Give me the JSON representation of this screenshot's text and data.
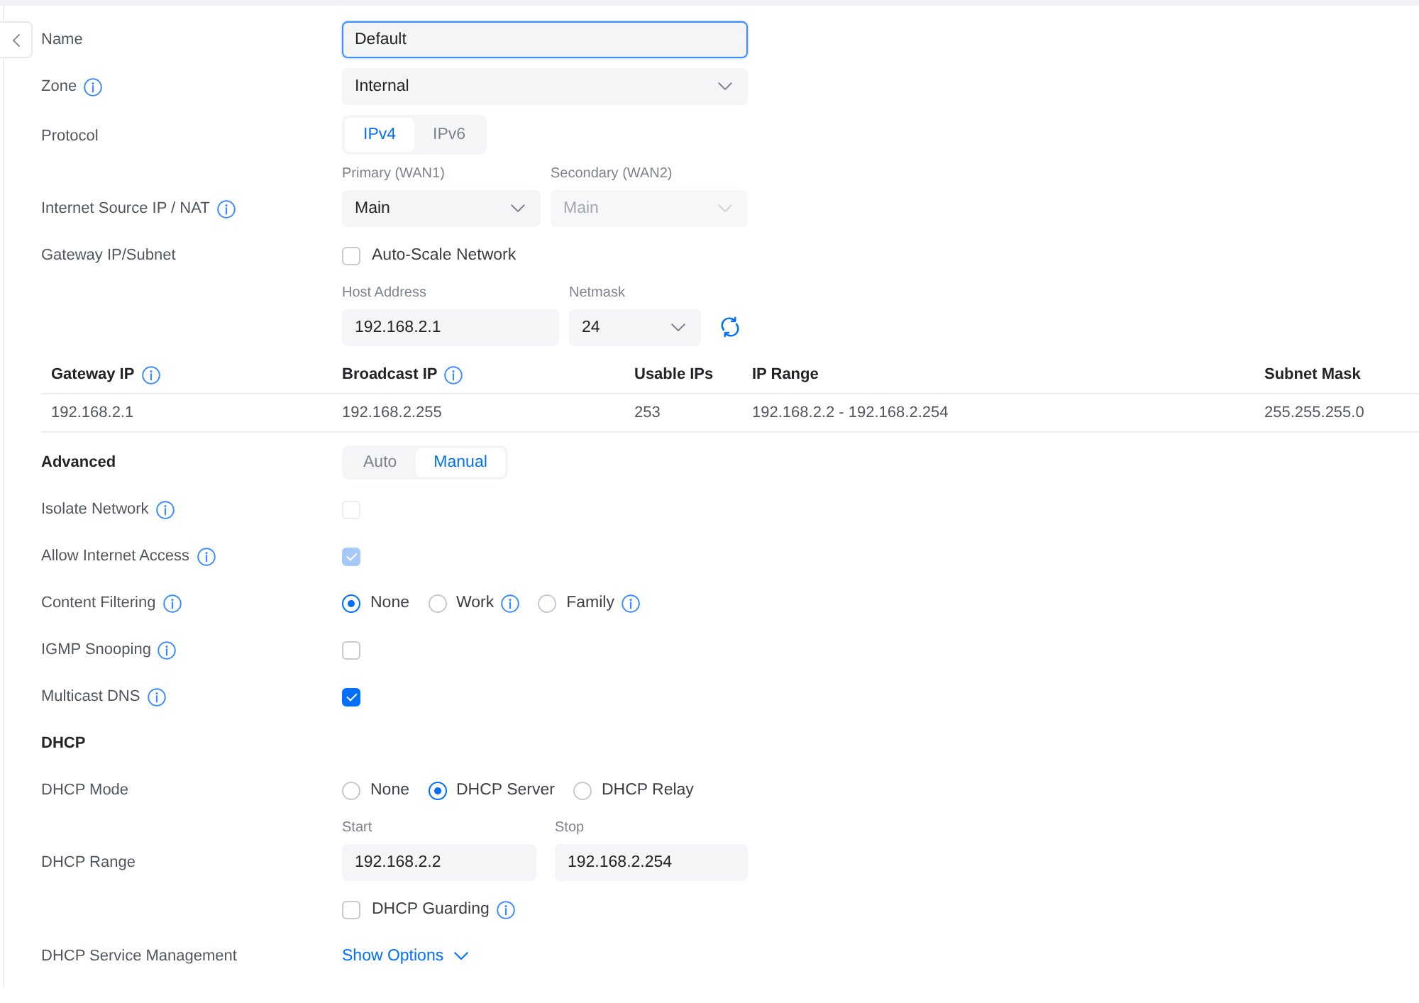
{
  "form_rows": [
    {
      "kind": "text",
      "label": "Name",
      "value": "Default",
      "focused": true
    },
    {
      "kind": "select",
      "label": "Zone",
      "info": true,
      "value": "Internal"
    },
    {
      "kind": "segmented",
      "label": "Protocol",
      "heading": false,
      "options": [
        {
          "label": "IPv4",
          "selected": true
        },
        {
          "label": "IPv6",
          "selected": false
        }
      ]
    },
    {
      "kind": "select_pair",
      "label": "Internet Source IP / NAT",
      "info": true,
      "selects": [
        {
          "caption": "Primary (WAN1)",
          "value": "Main",
          "disabled": false
        },
        {
          "caption": "Secondary (WAN2)",
          "value": "Main",
          "disabled": true
        }
      ]
    },
    {
      "kind": "checkbox",
      "label": "Gateway IP/Subnet",
      "text": "Auto-Scale Network",
      "checked": false,
      "disabled": false
    },
    {
      "kind": "address",
      "host": {
        "caption": "Host Address",
        "value": "192.168.2.1"
      },
      "netmask": {
        "caption": "Netmask",
        "value": "24"
      }
    },
    {
      "kind": "table",
      "columns": [
        {
          "label": "Gateway IP",
          "info": true
        },
        {
          "label": "Broadcast IP",
          "info": true
        },
        {
          "label": "Usable IPs"
        },
        {
          "label": "IP Range"
        },
        {
          "label": "Subnet Mask"
        }
      ],
      "rows": [
        [
          "192.168.2.1",
          "192.168.2.255",
          "253",
          "192.168.2.2 - 192.168.2.254",
          "255.255.255.0"
        ]
      ]
    },
    {
      "kind": "segmented",
      "label": "Advanced",
      "heading": true,
      "options": [
        {
          "label": "Auto",
          "selected": false
        },
        {
          "label": "Manual",
          "selected": true
        }
      ]
    },
    {
      "kind": "checkbox",
      "label": "Isolate Network",
      "info": true,
      "checked": false,
      "disabled": true
    },
    {
      "kind": "checkbox",
      "label": "Allow Internet Access",
      "info": true,
      "checked": true,
      "disabled": true
    },
    {
      "kind": "radio",
      "label": "Content Filtering",
      "info": true,
      "options": [
        {
          "label": "None",
          "selected": true
        },
        {
          "label": "Work",
          "selected": false,
          "info": true
        },
        {
          "label": "Family",
          "selected": false,
          "info": true
        }
      ]
    },
    {
      "kind": "checkbox",
      "label": "IGMP Snooping",
      "info": true,
      "checked": false,
      "disabled": false
    },
    {
      "kind": "checkbox",
      "label": "Multicast DNS",
      "info": true,
      "checked": true,
      "disabled": false
    },
    {
      "kind": "heading",
      "label": "DHCP"
    },
    {
      "kind": "radio",
      "label": "DHCP Mode",
      "options": [
        {
          "label": "None",
          "selected": false
        },
        {
          "label": "DHCP Server",
          "selected": true
        },
        {
          "label": "DHCP Relay",
          "selected": false
        }
      ]
    },
    {
      "kind": "range",
      "label": "DHCP Range",
      "inputs": [
        {
          "caption": "Start",
          "value": "192.168.2.2"
        },
        {
          "caption": "Stop",
          "value": "192.168.2.254"
        }
      ]
    },
    {
      "kind": "checkbox",
      "text": "DHCP Guarding",
      "text_info": true,
      "checked": false,
      "disabled": false
    },
    {
      "kind": "link",
      "label": "DHCP Service Management",
      "link": "Show Options",
      "expanded": false
    }
  ]
}
